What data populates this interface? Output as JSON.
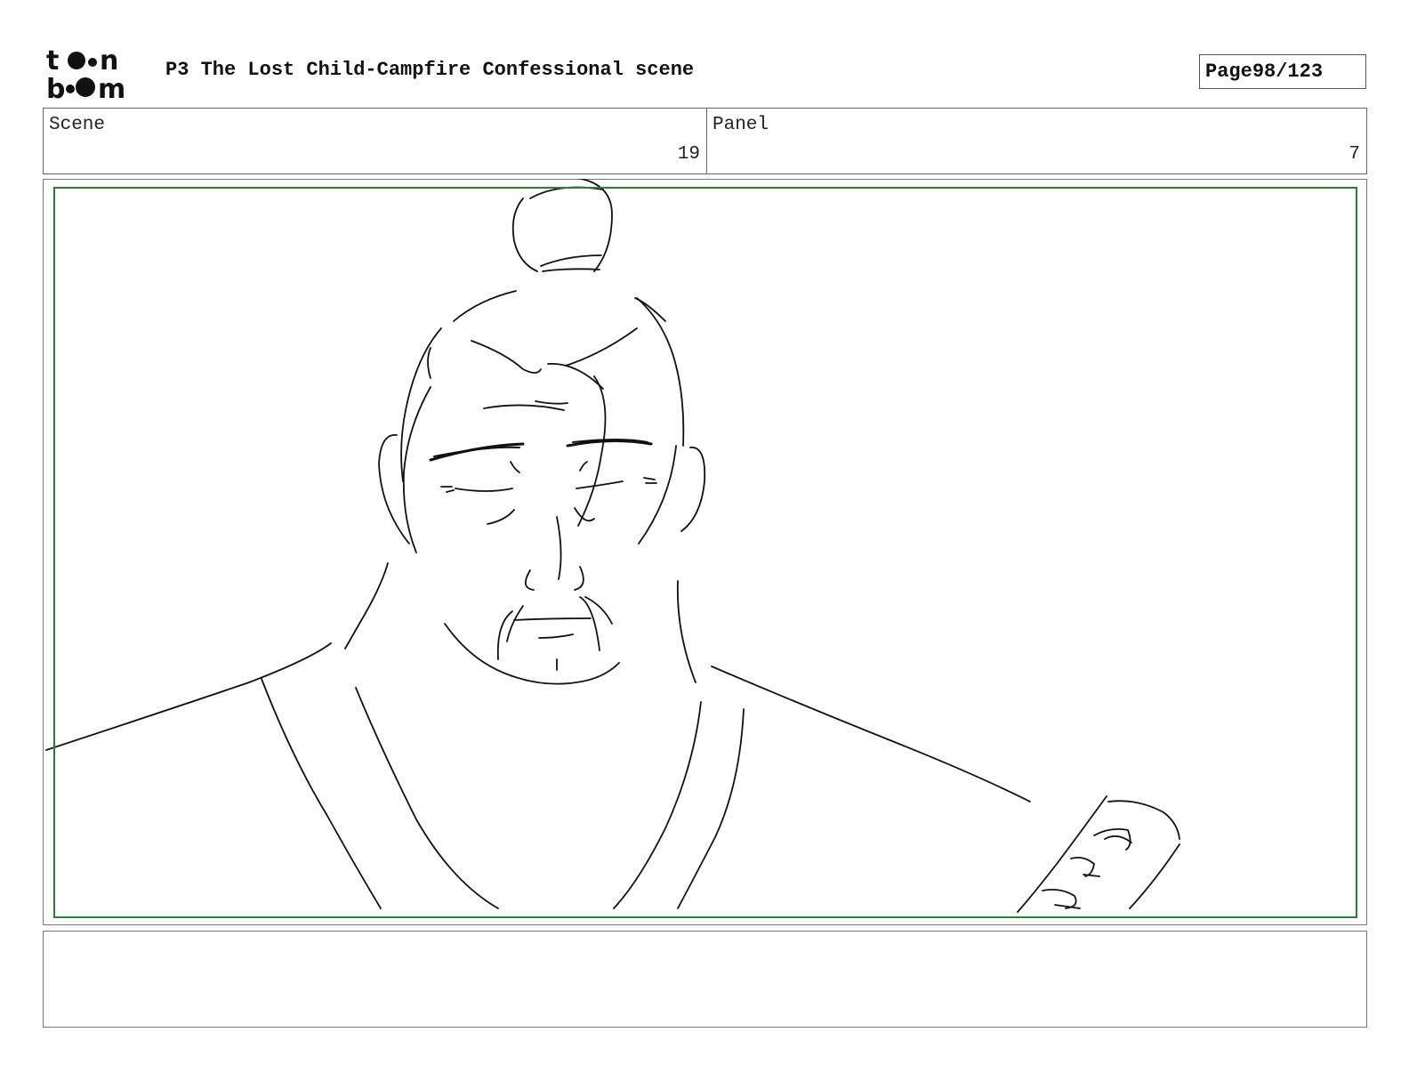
{
  "header": {
    "logo_text": "toon boom",
    "title": "P3 The Lost Child-Campfire Confessional scene",
    "page_label": "Page",
    "page_number": "98/123"
  },
  "info": {
    "scene_label": "Scene",
    "scene_value": "19",
    "panel_label": "Panel",
    "panel_value": "7"
  },
  "notes": {
    "text": ""
  }
}
